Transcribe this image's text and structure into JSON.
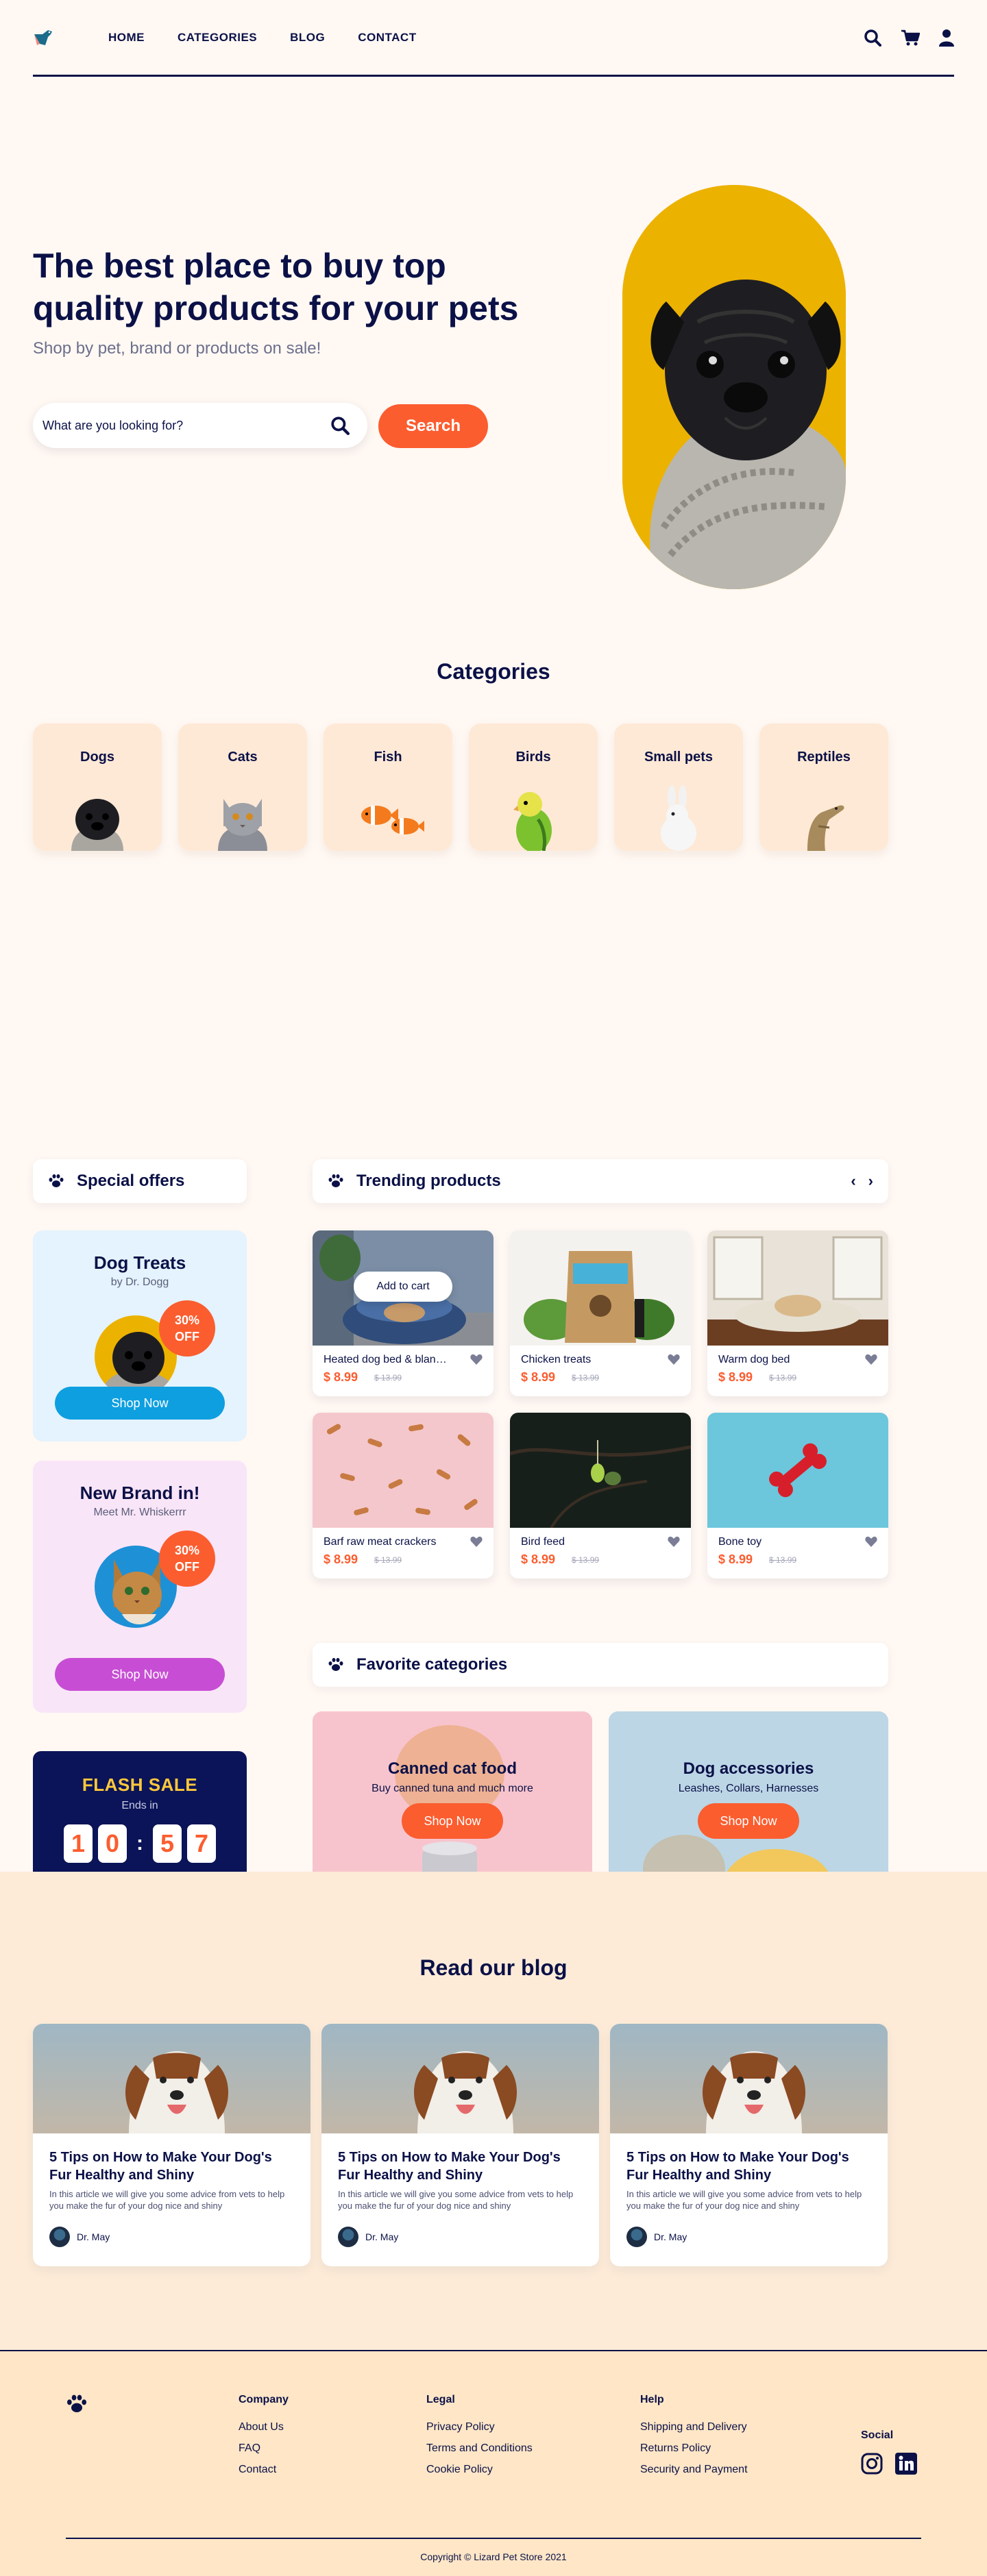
{
  "header": {
    "nav": [
      "HOME",
      "CATEGORIES",
      "BLOG",
      "CONTACT"
    ]
  },
  "hero": {
    "title": "The best place to buy top quality products for your pets",
    "subtitle": "Shop by pet, brand or products on sale!",
    "search_placeholder": "What are you looking for?",
    "search_button": "Search"
  },
  "categories": {
    "title": "Categories",
    "items": [
      {
        "label": "Dogs",
        "icon": "pug"
      },
      {
        "label": "Cats",
        "icon": "cat"
      },
      {
        "label": "Fish",
        "icon": "clownfish"
      },
      {
        "label": "Birds",
        "icon": "parakeet"
      },
      {
        "label": "Small pets",
        "icon": "rabbit"
      },
      {
        "label": "Reptiles",
        "icon": "lizard"
      }
    ]
  },
  "special_offers": {
    "title": "Special offers",
    "cards": [
      {
        "title": "Dog Treats",
        "subtitle": "by Dr. Dogg",
        "badge_line1": "30%",
        "badge_line2": "OFF",
        "button": "Shop Now",
        "bg": "#e4f3fd",
        "button_color": "#0e9fe0"
      },
      {
        "title": "New Brand in!",
        "subtitle": "Meet Mr. Whiskerrr",
        "badge_line1": "30%",
        "badge_line2": "OFF",
        "button": "Shop Now",
        "bg": "#f9e5f8",
        "button_color": "#c74ed4"
      }
    ],
    "flash": {
      "title": "FLASH SALE",
      "subtitle": "Ends in",
      "digits": [
        "1",
        "0",
        "5",
        "7"
      ]
    }
  },
  "trending": {
    "title": "Trending products",
    "prev": "‹",
    "next": "›",
    "add_to_cart": "Add to cart",
    "products": [
      {
        "name": "Heated dog bed & blanket",
        "price": "$ 8.99",
        "old_price": "$ 13.99"
      },
      {
        "name": "Chicken treats",
        "price": "$ 8.99",
        "old_price": "$ 13.99"
      },
      {
        "name": "Warm dog bed",
        "price": "$ 8.99",
        "old_price": "$ 13.99"
      },
      {
        "name": "Barf raw meat crackers",
        "price": "$ 8.99",
        "old_price": "$ 13.99"
      },
      {
        "name": "Bird feed",
        "price": "$ 8.99",
        "old_price": "$ 13.99"
      },
      {
        "name": "Bone toy",
        "price": "$ 8.99",
        "old_price": "$ 13.99"
      }
    ]
  },
  "favorite_categories": {
    "title": "Favorite categories",
    "cards": [
      {
        "title": "Canned cat food",
        "subtitle": "Buy canned tuna and much more",
        "button": "Shop Now",
        "bg": "#f7c4cd"
      },
      {
        "title": "Dog accessories",
        "subtitle": "Leashes, Collars, Harnesses",
        "button": "Shop Now",
        "bg": "#bcd6e6"
      }
    ]
  },
  "blog": {
    "title": "Read our blog",
    "posts": [
      {
        "title": "5 Tips on How to Make Your Dog's Fur Healthy and Shiny",
        "excerpt": "In this article we will give you some advice from vets to help you make the fur of your dog nice and shiny",
        "author": "Dr. May"
      },
      {
        "title": "5 Tips on How to Make Your Dog's Fur Healthy and Shiny",
        "excerpt": "In this article we will give you some advice from vets to help you make the fur of your dog nice and shiny",
        "author": "Dr. May"
      },
      {
        "title": "5 Tips on How to Make Your Dog's Fur Healthy and Shiny",
        "excerpt": "In this article we will give you some advice from vets to help you make the fur of your dog nice and shiny",
        "author": "Dr. May"
      }
    ]
  },
  "footer": {
    "company": {
      "title": "Company",
      "links": [
        "About Us",
        "FAQ",
        "Contact"
      ]
    },
    "legal": {
      "title": "Legal",
      "links": [
        "Privacy Policy",
        "Terms and Conditions",
        "Cookie Policy"
      ]
    },
    "help": {
      "title": "Help",
      "links": [
        "Shipping and Delivery",
        "Returns Policy",
        "Security and Payment"
      ]
    },
    "social": {
      "title": "Social",
      "icons": [
        "instagram-icon",
        "linkedin-icon"
      ]
    },
    "copyright": "Copyright © Lizard Pet Store 2021"
  },
  "colors": {
    "navy": "#0b1147",
    "accent": "#fb5d2f",
    "page_bg": "#fff8f3",
    "card_bg": "#fee9d6",
    "hero_yellow": "#ecb200"
  }
}
